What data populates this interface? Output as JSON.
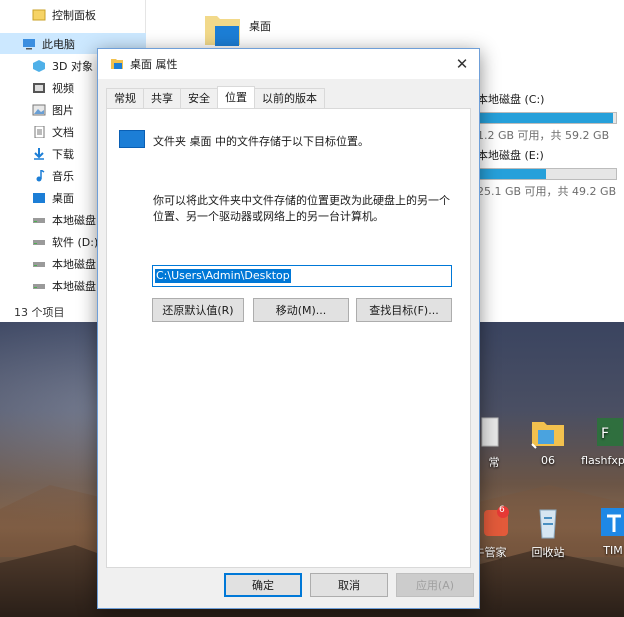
{
  "explorer": {
    "nav_items": [
      {
        "label": "控制面板",
        "icon": "control-panel-icon"
      },
      {
        "label": "此电脑",
        "icon": "computer-icon"
      },
      {
        "label": "3D 对象",
        "icon": "3d-objects-icon"
      },
      {
        "label": "视频",
        "icon": "video-icon"
      },
      {
        "label": "图片",
        "icon": "pictures-icon"
      },
      {
        "label": "文档",
        "icon": "documents-icon"
      },
      {
        "label": "下载",
        "icon": "download-icon"
      },
      {
        "label": "音乐",
        "icon": "music-icon"
      },
      {
        "label": "桌面",
        "icon": "desktop-icon"
      },
      {
        "label": "本地磁盘",
        "icon": "drive-icon"
      },
      {
        "label": "软件 (D:)",
        "icon": "drive-icon"
      },
      {
        "label": "本地磁盘",
        "icon": "drive-icon"
      },
      {
        "label": "本地磁盘",
        "icon": "drive-icon"
      }
    ],
    "status": "13 个项目",
    "folder_label": "桌面",
    "drives": [
      {
        "name": "本地磁盘 (C:)",
        "info": "1.2 GB 可用，共 59.2 GB",
        "used_fraction": 0.98
      },
      {
        "name": "本地磁盘 (E:)",
        "info": "25.1 GB 可用，共 49.2 GB",
        "used_fraction": 0.49
      }
    ]
  },
  "desktop_icons": [
    {
      "label": "常",
      "icon": "partial-app-icon"
    },
    {
      "label": "06",
      "icon": "folder-icon"
    },
    {
      "label": "flashfxp",
      "icon": "flashfxp-icon"
    },
    {
      "label": "牛管家",
      "icon": "app-icon"
    },
    {
      "label": "回收站",
      "icon": "recycle-bin-icon"
    },
    {
      "label": "TIM",
      "icon": "tim-icon"
    }
  ],
  "desktop_badge": "6",
  "dialog": {
    "title": "桌面 属性",
    "tabs": [
      "常规",
      "共享",
      "安全",
      "位置",
      "以前的版本"
    ],
    "active_tab": "位置",
    "header_text": "文件夹 桌面 中的文件存储于以下目标位置。",
    "description": "你可以将此文件夹中文件存储的位置更改为此硬盘上的另一个位置、另一个驱动器或网络上的另一台计算机。",
    "path_value": "C:\\Users\\Admin\\Desktop",
    "restore_button": "还原默认值(R)",
    "move_button": "移动(M)...",
    "find_button": "查找目标(F)...",
    "ok_button": "确定",
    "cancel_button": "取消",
    "apply_button": "应用(A)"
  },
  "colors": {
    "accent": "#0078d7",
    "drive_fill": "#26a0da",
    "folder_blue": "#1c7ed6"
  }
}
